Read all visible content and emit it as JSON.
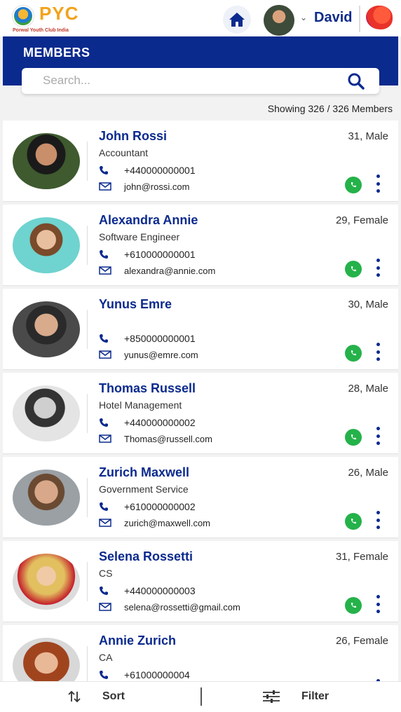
{
  "header": {
    "logo_text": "PYC",
    "logo_subtitle": "Porwal Youth Club India",
    "home_icon": "home-icon",
    "user_name": "David",
    "brand_icon": "brand-logo-icon"
  },
  "banner": {
    "title": "MEMBERS"
  },
  "search": {
    "placeholder": "Search...",
    "icon": "search-icon"
  },
  "summary": {
    "showing_text": "Showing 326 / 326 Members"
  },
  "members": [
    {
      "name": "John Rossi",
      "job": "Accountant",
      "age_gender": "31, Male",
      "phone": "+440000000001",
      "email": "john@rossi.com"
    },
    {
      "name": "Alexandra Annie",
      "job": "Software Engineer",
      "age_gender": "29, Female",
      "phone": "+610000000001",
      "email": "alexandra@annie.com"
    },
    {
      "name": "Yunus Emre",
      "job": "",
      "age_gender": "30, Male",
      "phone": "+850000000001",
      "email": "yunus@emre.com"
    },
    {
      "name": "Thomas Russell",
      "job": "Hotel Management",
      "age_gender": "28, Male",
      "phone": "+440000000002",
      "email": "Thomas@russell.com"
    },
    {
      "name": "Zurich Maxwell",
      "job": "Government Service",
      "age_gender": "26, Male",
      "phone": "+610000000002",
      "email": "zurich@maxwell.com"
    },
    {
      "name": "Selena Rossetti",
      "job": "CS",
      "age_gender": "31, Female",
      "phone": "+440000000003",
      "email": "selena@rossetti@gmail.com"
    },
    {
      "name": "Annie Zurich",
      "job": "CA",
      "age_gender": "26, Female",
      "phone": "+61000000004",
      "email": ""
    }
  ],
  "bottom_bar": {
    "sort_label": "Sort",
    "filter_label": "Filter"
  },
  "colors": {
    "primary": "#0b2a8e",
    "accent_logo": "#f2a31b",
    "whatsapp": "#25b24a",
    "background": "#f2f2f2"
  }
}
